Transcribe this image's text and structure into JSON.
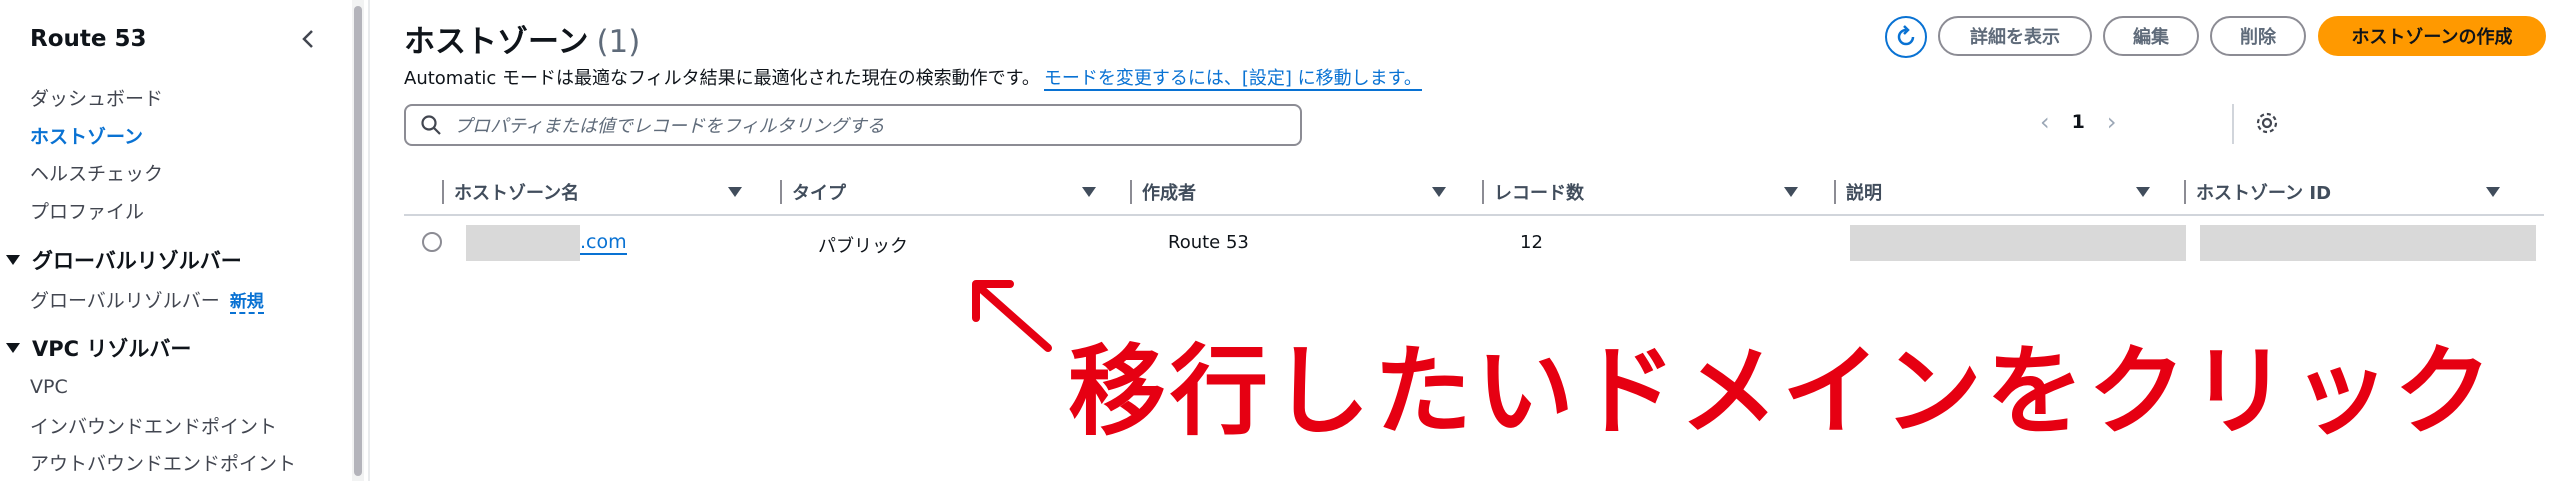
{
  "sidebar": {
    "title": "Route 53",
    "links_top": [
      {
        "label": "ダッシュボード",
        "active": false
      },
      {
        "label": "ホストゾーン",
        "active": true
      },
      {
        "label": "ヘルスチェック",
        "active": false
      },
      {
        "label": "プロファイル",
        "active": false
      }
    ],
    "section_global": {
      "title": "グローバルリゾルバー",
      "item": "グローバルリゾルバー",
      "badge": "新規"
    },
    "section_vpc": {
      "title": "VPC リゾルバー",
      "items": [
        "VPC",
        "インバウンドエンドポイント",
        "アウトバウンドエンドポイント"
      ]
    }
  },
  "header": {
    "title": "ホストゾーン",
    "count": "(1)",
    "description": "Automatic モードは最適なフィルタ結果に最適化された現在の検索動作です。",
    "description_link": "モードを変更するには、[設定] に移動します。",
    "buttons": {
      "details": "詳細を表示",
      "edit": "編集",
      "delete": "削除",
      "create": "ホストゾーンの作成"
    }
  },
  "search": {
    "placeholder": "プロパティまたは値でレコードをフィルタリングする"
  },
  "pagination": {
    "current_page": "1",
    "prev": "‹",
    "next": "›"
  },
  "table": {
    "columns": [
      "ホストゾーン名",
      "タイプ",
      "作成者",
      "レコード数",
      "説明",
      "ホストゾーン ID"
    ],
    "rows": [
      {
        "name_suffix": ".com",
        "type": "パブリック",
        "created_by": "Route 53",
        "record_count": "12"
      }
    ]
  },
  "annotation": {
    "text": "移行したいドメインをクリック",
    "color": "#e60012"
  },
  "colors": {
    "accent": "#0972d3",
    "primary_button": "#ff9900"
  }
}
